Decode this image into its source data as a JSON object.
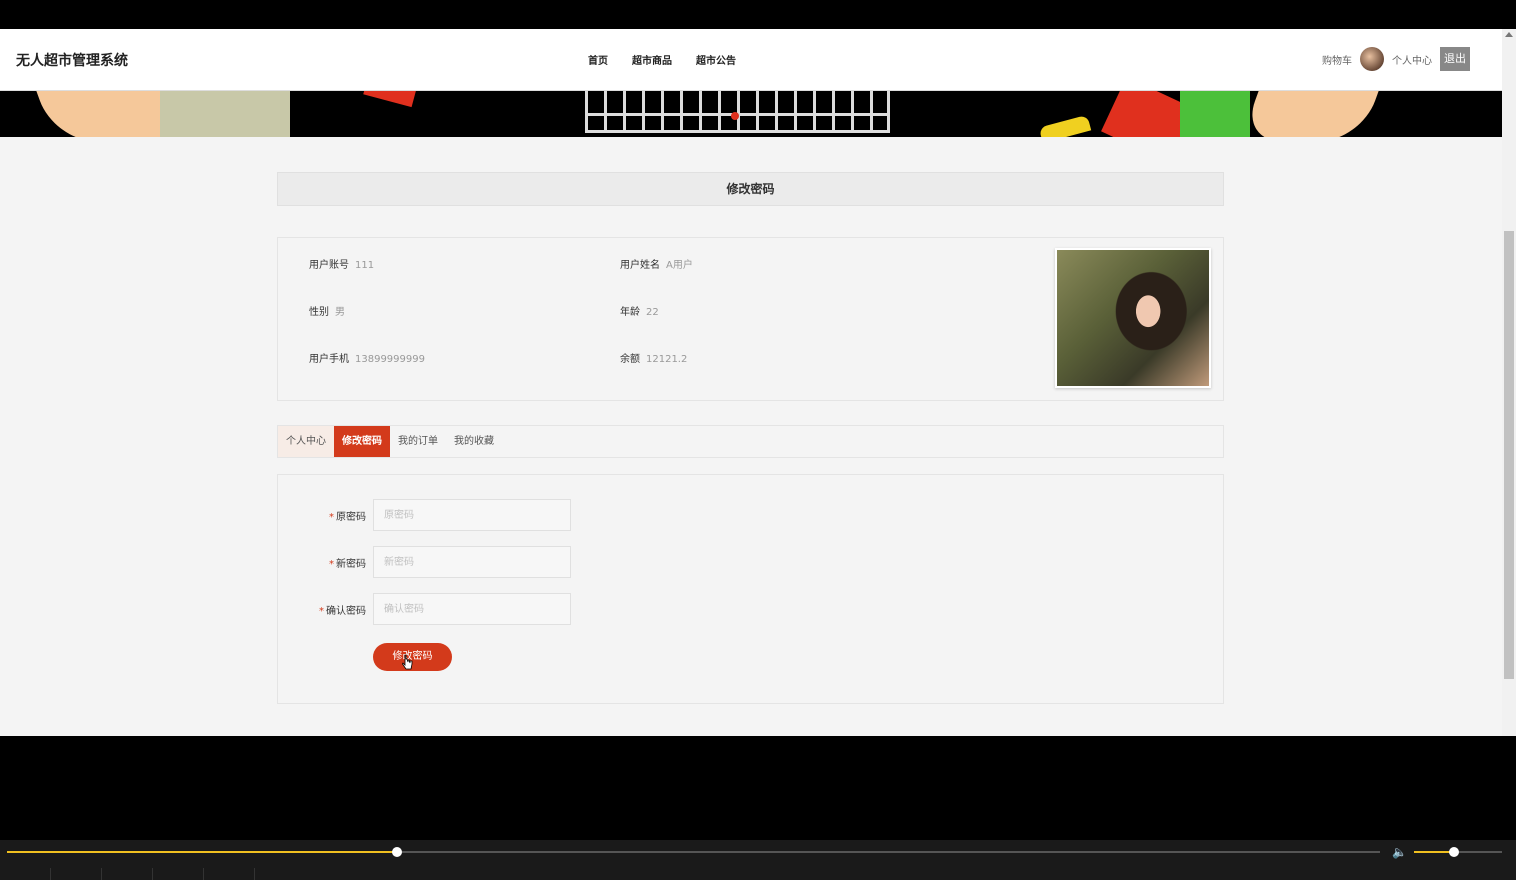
{
  "header": {
    "brand": "无人超市管理系统",
    "nav": [
      "首页",
      "超市商品",
      "超市公告"
    ],
    "cart_label": "购物车",
    "personal_center_label": "个人中心",
    "logout_label": "退出"
  },
  "page_title": "修改密码",
  "user_info": {
    "account_label": "用户账号",
    "account_value": "111",
    "name_label": "用户姓名",
    "name_value": "A用户",
    "gender_label": "性别",
    "gender_value": "男",
    "age_label": "年龄",
    "age_value": "22",
    "phone_label": "用户手机",
    "phone_value": "13899999999",
    "balance_label": "余额",
    "balance_value": "12121.2"
  },
  "tabs": [
    "个人中心",
    "修改密码",
    "我的订单",
    "我的收藏"
  ],
  "active_tab": "修改密码",
  "form": {
    "required_mark": "*",
    "old_password_label": "原密码",
    "old_password_placeholder": "原密码",
    "new_password_label": "新密码",
    "new_password_placeholder": "新密码",
    "confirm_password_label": "确认密码",
    "confirm_password_placeholder": "确认密码",
    "submit_label": "修改密码"
  },
  "player": {
    "progress": 0.284,
    "volume": 0.45
  },
  "colors": {
    "accent": "#d33a1b",
    "progress": "#f0c020"
  }
}
